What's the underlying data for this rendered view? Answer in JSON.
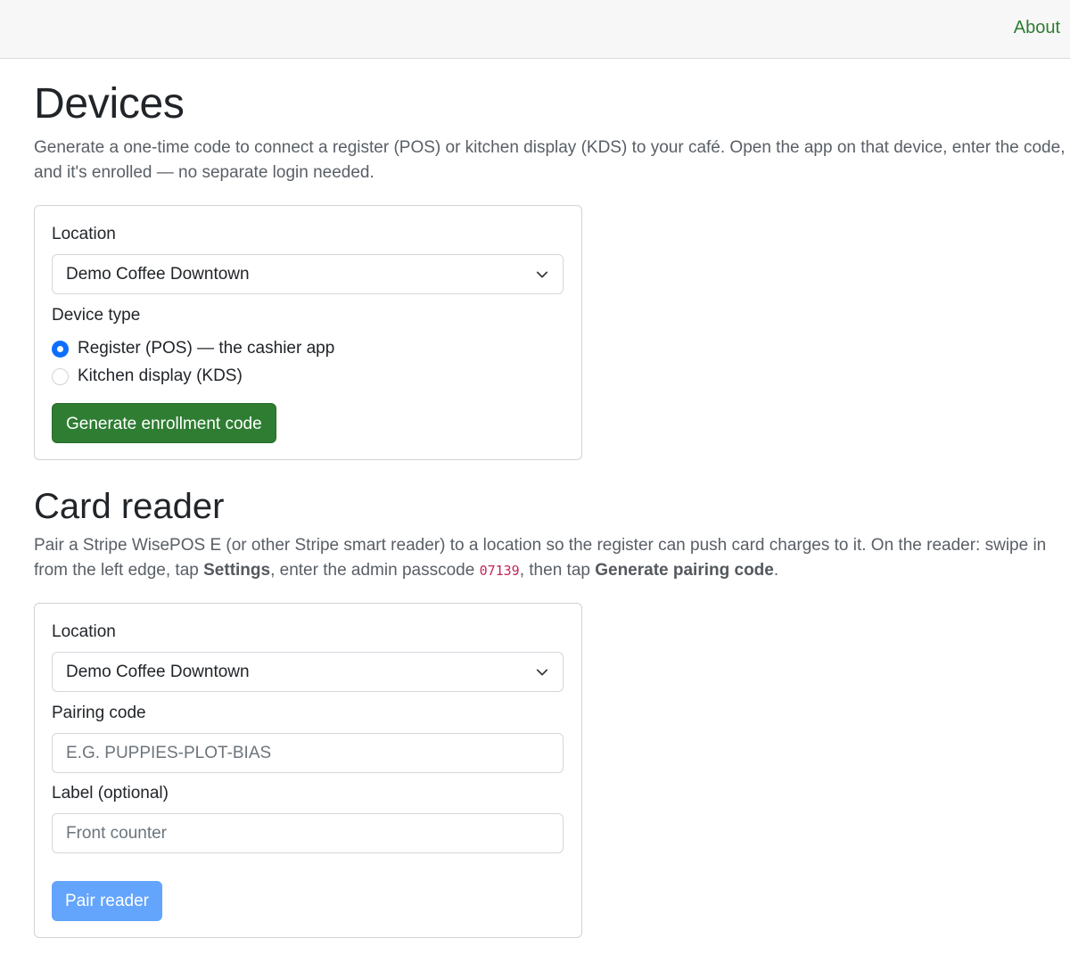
{
  "nav": {
    "about_label": "About"
  },
  "devices": {
    "title": "Devices",
    "description": "Generate a one-time code to connect a register (POS) or kitchen display (KDS) to your café. Open the app on that device, enter the code, and it's enrolled — no separate login needed.",
    "location_label": "Location",
    "location_value": "Demo Coffee Downtown",
    "device_type_label": "Device type",
    "device_types": [
      {
        "label": "Register (POS) — the cashier app",
        "checked": true
      },
      {
        "label": "Kitchen display (KDS)",
        "checked": false
      }
    ],
    "generate_button": "Generate enrollment code"
  },
  "card_reader": {
    "title": "Card reader",
    "description_part1": "Pair a Stripe WisePOS E (or other Stripe smart reader) to a location so the register can push card charges to it. On the reader: swipe in from the left edge, tap ",
    "settings_word": "Settings",
    "description_part2": ", enter the admin passcode ",
    "passcode": "07139",
    "description_part3": ", then tap ",
    "generate_pairing_word": "Generate pairing code",
    "description_part4": ".",
    "location_label": "Location",
    "location_value": "Demo Coffee Downtown",
    "pairing_label": "Pairing code",
    "pairing_placeholder": "E.G. PUPPIES-PLOT-BIAS",
    "label_label": "Label (optional)",
    "label_placeholder": "Front counter",
    "pair_button": "Pair reader"
  },
  "colors": {
    "accent_green": "#2e7d32",
    "primary_blue_disabled": "#63a4fd",
    "radio_checked": "#0d6efd",
    "code_pink": "#c2255c"
  },
  "icons": {
    "select_caret": "chevron-down-icon"
  }
}
